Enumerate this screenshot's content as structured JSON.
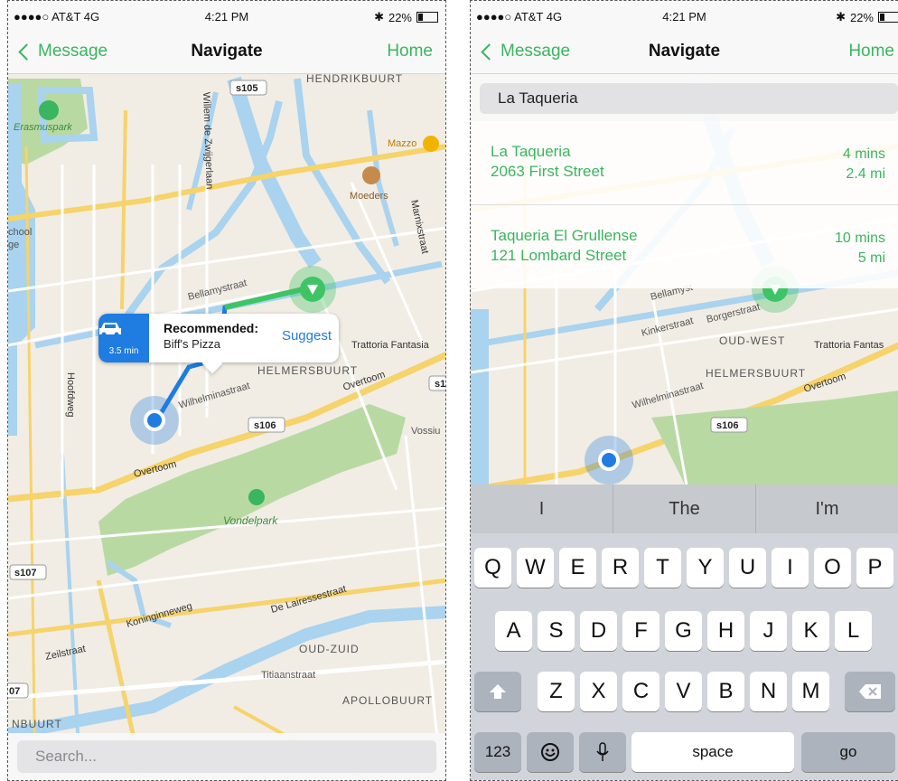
{
  "colors": {
    "accent": "#3bb55f",
    "blue": "#1f7ce0"
  },
  "left": {
    "status": {
      "signal": "●●●●○ AT&T 4G",
      "time": "4:21 PM",
      "battery": "22%",
      "bt_icon": "bluetooth-icon",
      "wifi_icon": "wifi-icon"
    },
    "nav": {
      "back": "Message",
      "title": "Navigate",
      "home": "Home"
    },
    "map_labels": {
      "s105": "s105",
      "s106": "s106",
      "s107": "s107",
      "s1": "s1",
      "n07": "07",
      "erasmuspark": "Erasmuspark",
      "mazzo": "Mazzo",
      "moeders": "Moeders",
      "vondelpark": "Vondelpark",
      "helmersbuurt": "HELMERSBUURT",
      "oud_zuid": "OUD-ZUID",
      "apollobuurt": "APOLLOBUURT",
      "overtoom1": "Overtoom",
      "overtoom2": "Overtoom",
      "trattoria": "Trattoria Fantasia",
      "bellamy": "Bellamystraat",
      "wilhelmina": "Wilhelminastraat",
      "hoofdweg": "Hoofdweg",
      "koninginneweg": "Koninginneweg",
      "delairesse": "De Lairessestraat",
      "zeilstraat": "Zeilstraat",
      "willem": "Willem de Zwijgerlaan",
      "marnix": "Marnixstraat",
      "hendrikbuurt": "HENDRIKBUURT",
      "nbuurt": "NBUURT",
      "titiaan": "Titiaanstraat",
      "school": "chool",
      "ge": "ge",
      "vossius": "Vossiu"
    },
    "callout": {
      "eta": "3.5 min",
      "rec": "Recommended:",
      "place": "Biff's Pizza",
      "suggest": "Suggest"
    },
    "search_placeholder": "Search..."
  },
  "right": {
    "status": {
      "signal": "●●●●○ AT&T 4G",
      "time": "4:21 PM",
      "battery": "22%"
    },
    "nav": {
      "back": "Message",
      "title": "Navigate",
      "home": "Home"
    },
    "query": "La Taqueria",
    "results": [
      {
        "name": "La Taqueria",
        "address": "2063 First Street",
        "time": "4 mins",
        "distance": "2.4 mi"
      },
      {
        "name": "Taqueria El Grullense",
        "address": "121 Lombard Street",
        "time": "10 mins",
        "distance": "5 mi"
      }
    ],
    "map_labels": {
      "oud_west": "OUD-WEST",
      "helmersbuurt": "HELMERSBUURT",
      "overtoom": "Overtoom",
      "trattoria": "Trattoria Fantas",
      "s106": "s106",
      "bellamy": "Bellamyst",
      "kinker": "Kinkerstraat",
      "borger": "Borgerstraat",
      "wilhelmina": "Wilhelminastraat"
    },
    "keyboard": {
      "predictions": [
        "I",
        "The",
        "I'm"
      ],
      "row1": [
        "Q",
        "W",
        "E",
        "R",
        "T",
        "Y",
        "U",
        "I",
        "O",
        "P"
      ],
      "row2": [
        "A",
        "S",
        "D",
        "F",
        "G",
        "H",
        "J",
        "K",
        "L"
      ],
      "row3": [
        "Z",
        "X",
        "C",
        "V",
        "B",
        "N",
        "M"
      ],
      "num": "123",
      "space": "space",
      "go": "go",
      "shift_icon": "shift-icon",
      "delete_icon": "backspace-icon",
      "emoji_icon": "emoji-icon",
      "mic_icon": "microphone-icon"
    }
  }
}
